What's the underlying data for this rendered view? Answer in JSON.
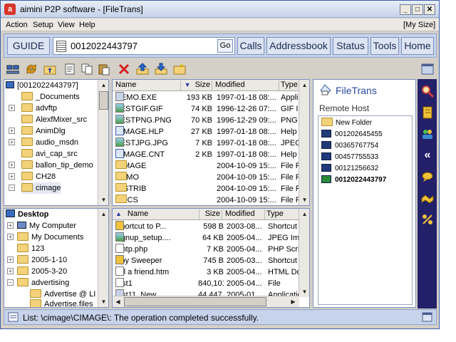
{
  "window": {
    "title": "aimini P2P software - [FileTrans]",
    "app_glyph": "a",
    "minimize": "_",
    "maximize": "□",
    "close": "✕"
  },
  "menu": {
    "action": "Action",
    "setup": "Setup",
    "view": "View",
    "help": "Help",
    "mysize": "[My Size]"
  },
  "guide": {
    "guide_label": "GUIDE",
    "address_value": "0012022443797",
    "go_label": "Go",
    "buttons": [
      "Calls",
      "Addressbook",
      "Status",
      "Tools",
      "Home"
    ]
  },
  "upper_tree": {
    "root": "[0012022443797]",
    "items": [
      "_Documents",
      "advftp",
      "AlexfMixer_src",
      "AnimDlg",
      "audio_msdn",
      "avi_cap_src",
      "ballon_tip_demo",
      "CH28",
      "cimage"
    ]
  },
  "upper_list": {
    "headers": {
      "name": "Name",
      "size": "Size",
      "modified": "Modified",
      "type": "Type"
    },
    "rows": [
      {
        "name": "DEMO.EXE",
        "size": "193 KB",
        "modified": "1997-01-18 08:...",
        "type": "Applica"
      },
      {
        "name": "TESTGIF.GIF",
        "size": "74 KB",
        "modified": "1996-12-26 07:...",
        "type": "GIF Im"
      },
      {
        "name": "TESTPNG.PNG",
        "size": "70 KB",
        "modified": "1996-12-29 09:...",
        "type": "PNG Im"
      },
      {
        "name": "CIMAGE.HLP",
        "size": "27 KB",
        "modified": "1997-01-18 08:...",
        "type": "Help F"
      },
      {
        "name": "TESTJPG.JPG",
        "size": "7 KB",
        "modified": "1997-01-18 08:...",
        "type": "JPEG I"
      },
      {
        "name": "CIMAGE.CNT",
        "size": "2 KB",
        "modified": "1997-01-18 08:...",
        "type": "Help C"
      },
      {
        "name": "CIMAGE",
        "size": "",
        "modified": "2004-10-09 15:...",
        "type": "File Fo"
      },
      {
        "name": "DEMO",
        "size": "",
        "modified": "2004-10-09 15:...",
        "type": "File Fo"
      },
      {
        "name": "DISTRIB",
        "size": "",
        "modified": "2004-10-09 15:...",
        "type": "File Fo"
      },
      {
        "name": "DOCS",
        "size": "",
        "modified": "2004-10-09 15:...",
        "type": "File Fo"
      }
    ]
  },
  "lower_tree": {
    "root": "Desktop",
    "items": [
      "My Computer",
      "My Documents",
      "123",
      "2005-1-10",
      "2005-3-20",
      "advertising",
      "Advertise @ LI Poli",
      "Advertise.files"
    ]
  },
  "lower_list": {
    "headers": {
      "name": "Name",
      "size": "Size",
      "modified": "Modified",
      "type": "Type"
    },
    "rows": [
      {
        "name": "Shortcut to P...",
        "size": "598 B",
        "modified": "2003-08...",
        "type": "Shortcut"
      },
      {
        "name": "signup_setup....",
        "size": "64 KB",
        "modified": "2005-04...",
        "type": "JPEG Imag"
      },
      {
        "name": "smtp.php",
        "size": "7 KB",
        "modified": "2005-04...",
        "type": "PHP Script"
      },
      {
        "name": "Spy Sweeper",
        "size": "745 B",
        "modified": "2005-03...",
        "type": "Shortcut"
      },
      {
        "name": "tell a friend.htm",
        "size": "3 KB",
        "modified": "2005-04...",
        "type": "HTML Docu"
      },
      {
        "name": "test1",
        "size": "840,101 KB",
        "modified": "2005-04...",
        "type": "File"
      },
      {
        "name": "test11_New_...",
        "size": "44,447 KB",
        "modified": "2005-01...",
        "type": "Application"
      }
    ]
  },
  "filetrans": {
    "title": "FileTrans",
    "remote_host_label": "Remote Host",
    "new_folder": "New Folder",
    "hosts": [
      "001202645455",
      "00365767754",
      "00457755533",
      "00121256632"
    ],
    "active_host": "0012022443797"
  },
  "status": {
    "text": "List: \\cimage\\CIMAGE\\: The operation completed successfully."
  },
  "colors": {
    "accent": "#3a5ea8",
    "sidebar": "#23206a",
    "guide_bg": "#c7d3ea"
  }
}
